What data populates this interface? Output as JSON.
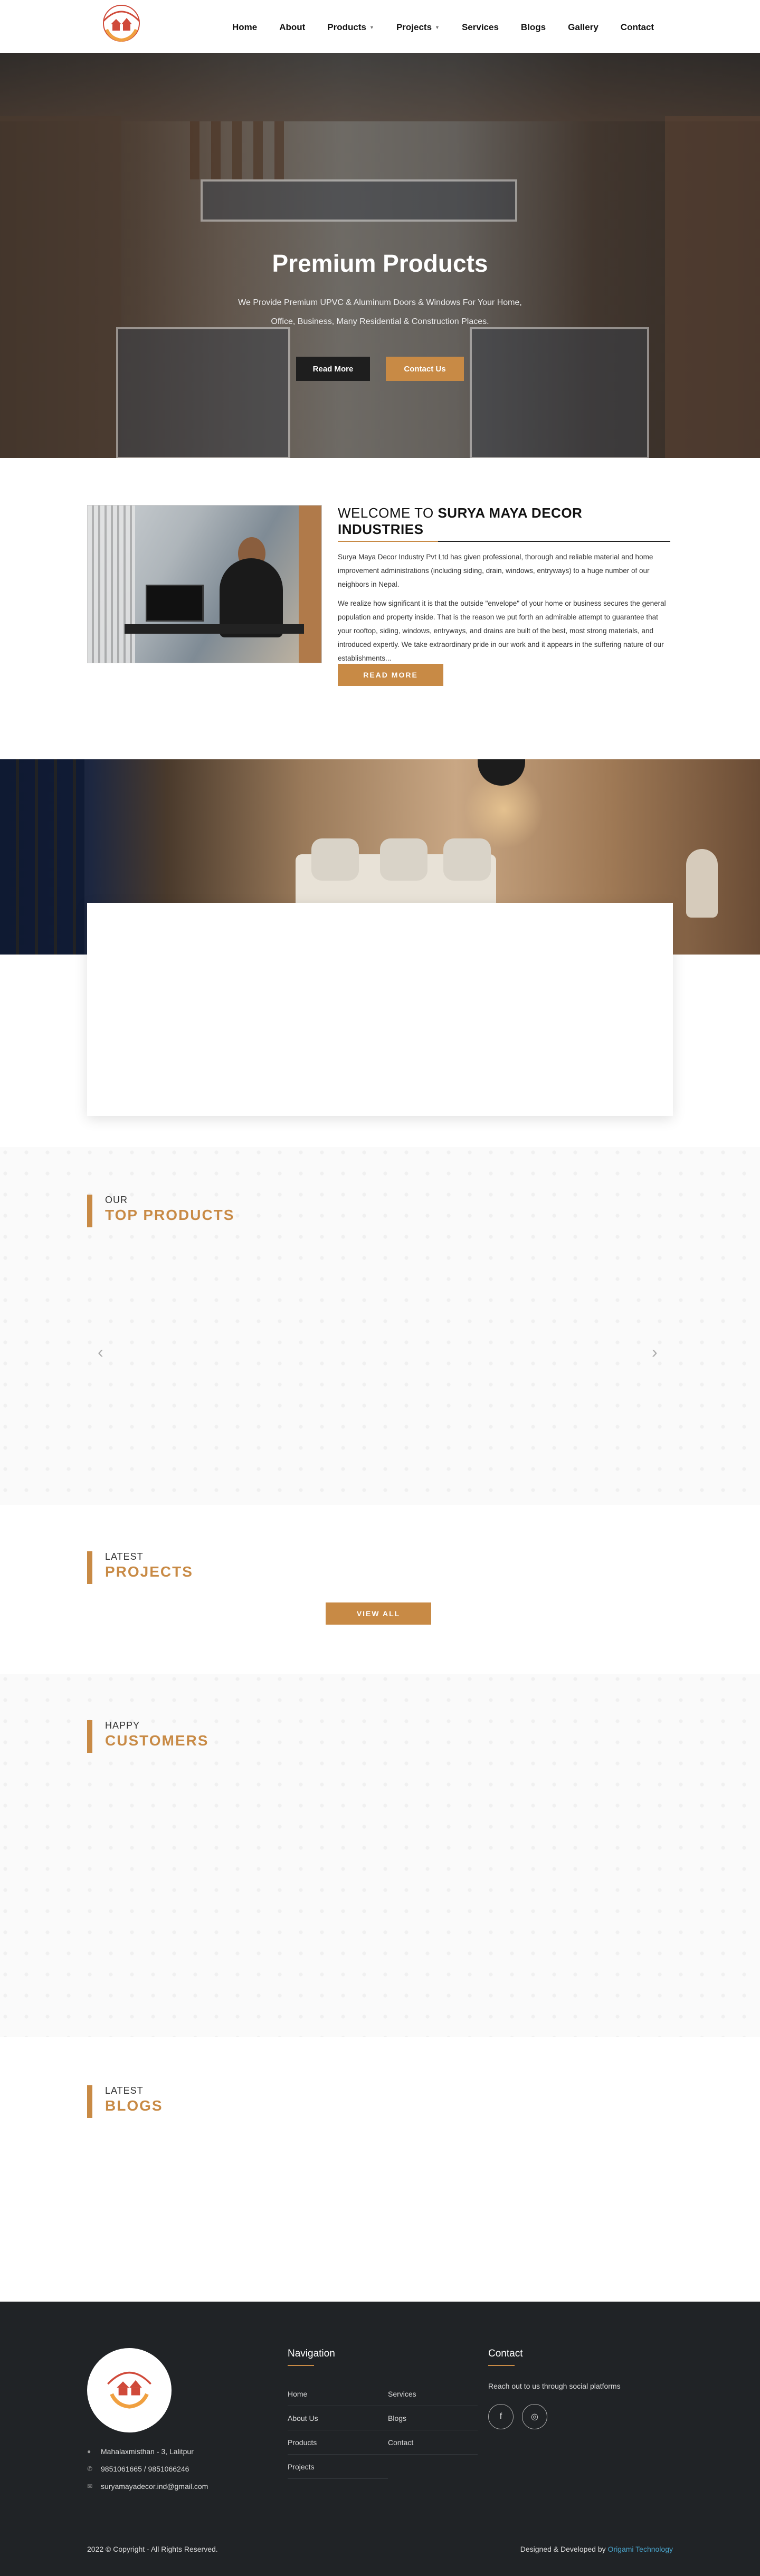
{
  "header": {
    "logo_icon": "house-hands-logo",
    "nav": [
      {
        "label": "Home",
        "has_caret": false
      },
      {
        "label": "About",
        "has_caret": false
      },
      {
        "label": "Products",
        "has_caret": true
      },
      {
        "label": "Projects",
        "has_caret": true
      },
      {
        "label": "Services",
        "has_caret": false
      },
      {
        "label": "Blogs",
        "has_caret": false
      },
      {
        "label": "Gallery",
        "has_caret": false
      },
      {
        "label": "Contact",
        "has_caret": false
      }
    ]
  },
  "hero": {
    "title": "Premium Products",
    "subtitle_line1": "We Provide Premium UPVC & Aluminum Doors & Windows For Your Home,",
    "subtitle_line2": "Office, Business, Many Residential & Construction Places.",
    "btn_read_more": "Read More",
    "btn_contact": "Contact Us"
  },
  "about": {
    "heading_prefix": "WELCOME TO ",
    "heading_strong": "SURYA MAYA DECOR INDUSTRIES",
    "para1": "Surya Maya Decor Industry Pvt Ltd has given professional, thorough and reliable material and home improvement administrations (including siding, drain, windows, entryways) to a huge number of our neighbors in Nepal.",
    "para2": "We realize how significant it is that the outside \"envelope\" of your home or business secures the general population and property inside. That is the reason we put forth an admirable attempt to guarantee that your rooftop, siding, windows, entryways, and drains are built of the best, most strong materials, and introduced expertly. We take extraordinary pride in our work and it appears in the suffering nature of our establishments...",
    "btn_label": "READ MORE"
  },
  "sections": {
    "products": {
      "small": "OUR",
      "big": "TOP PRODUCTS",
      "prev": "‹",
      "next": "›"
    },
    "projects": {
      "small": "LATEST",
      "big": "PROJECTS",
      "btn": "VIEW ALL"
    },
    "customers": {
      "small": "HAPPY",
      "big": "CUSTOMERS"
    },
    "blogs": {
      "small": "LATEST",
      "big": "BLOGS"
    }
  },
  "footer": {
    "address": "Mahalaxmisthan - 3, Lalitpur",
    "phone": "9851061665 / 9851066246",
    "email": "suryamayadecor.ind@gmail.com",
    "nav_title": "Navigation",
    "nav_links": [
      "Home",
      "Services",
      "About Us",
      "Blogs",
      "Products",
      "Contact",
      "Projects"
    ],
    "contact_title": "Contact",
    "contact_text": "Reach out to us through social platforms",
    "copyright": "2022 © Copyright - All Rights Reserved.",
    "dev_prefix": "Designed & Developed by ",
    "dev_name": "Origami Technology"
  },
  "colors": {
    "accent": "#c88a45",
    "footer_bg": "#202326",
    "dev_link": "#4aa3c9"
  }
}
